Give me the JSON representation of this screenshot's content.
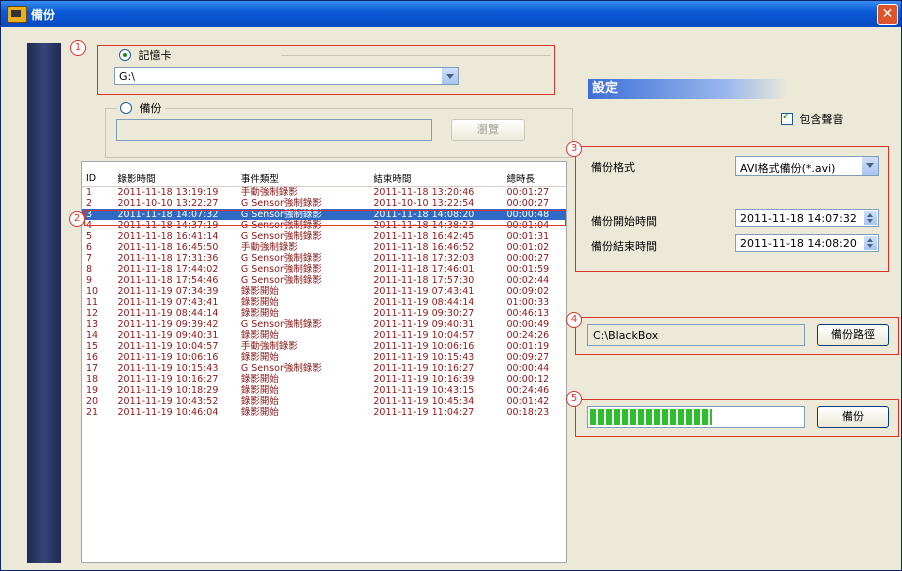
{
  "window": {
    "title": "備份",
    "close_label": "✕"
  },
  "memory_card": {
    "label": "記憶卡",
    "selected": true,
    "drive": "G:\\"
  },
  "backup_source": {
    "label": "備份",
    "selected": false,
    "path": "",
    "browse_label": "瀏覽"
  },
  "list": {
    "columns": [
      "ID",
      "錄影時間",
      "事件類型",
      "結束時間",
      "總時長"
    ],
    "selected_index": 2,
    "rows": [
      [
        "1",
        "2011-11-18 13:19:19",
        "手動強制錄影",
        "2011-11-18 13:20:46",
        "00:01:27"
      ],
      [
        "2",
        "2011-10-10 13:22:27",
        "G Sensor強制錄影",
        "2011-10-10 13:22:54",
        "00:00:27"
      ],
      [
        "3",
        "2011-11-18 14:07:32",
        "G Sensor強制錄影",
        "2011-11-18 14:08:20",
        "00:00:48"
      ],
      [
        "4",
        "2011-11-18 14:37:19",
        "G Sensor強制錄影",
        "2011-11-18 14:38:23",
        "00:01:04"
      ],
      [
        "5",
        "2011-11-18 16:41:14",
        "G Sensor強制錄影",
        "2011-11-18 16:42:45",
        "00:01:31"
      ],
      [
        "6",
        "2011-11-18 16:45:50",
        "手動強制錄影",
        "2011-11-18 16:46:52",
        "00:01:02"
      ],
      [
        "7",
        "2011-11-18 17:31:36",
        "G Sensor強制錄影",
        "2011-11-18 17:32:03",
        "00:00:27"
      ],
      [
        "8",
        "2011-11-18 17:44:02",
        "G Sensor強制錄影",
        "2011-11-18 17:46:01",
        "00:01:59"
      ],
      [
        "9",
        "2011-11-18 17:54:46",
        "G Sensor強制錄影",
        "2011-11-18 17:57:30",
        "00:02:44"
      ],
      [
        "10",
        "2011-11-19 07:34:39",
        "錄影開始",
        "2011-11-19 07:43:41",
        "00:09:02"
      ],
      [
        "11",
        "2011-11-19 07:43:41",
        "錄影開始",
        "2011-11-19 08:44:14",
        "01:00:33"
      ],
      [
        "12",
        "2011-11-19 08:44:14",
        "錄影開始",
        "2011-11-19 09:30:27",
        "00:46:13"
      ],
      [
        "13",
        "2011-11-19 09:39:42",
        "G Sensor強制錄影",
        "2011-11-19 09:40:31",
        "00:00:49"
      ],
      [
        "14",
        "2011-11-19 09:40:31",
        "錄影開始",
        "2011-11-19 10:04:57",
        "00:24:26"
      ],
      [
        "15",
        "2011-11-19 10:04:57",
        "手動強制錄影",
        "2011-11-19 10:06:16",
        "00:01:19"
      ],
      [
        "16",
        "2011-11-19 10:06:16",
        "錄影開始",
        "2011-11-19 10:15:43",
        "00:09:27"
      ],
      [
        "17",
        "2011-11-19 10:15:43",
        "G Sensor強制錄影",
        "2011-11-19 10:16:27",
        "00:00:44"
      ],
      [
        "18",
        "2011-11-19 10:16:27",
        "錄影開始",
        "2011-11-19 10:16:39",
        "00:00:12"
      ],
      [
        "19",
        "2011-11-19 10:18:29",
        "錄影開始",
        "2011-11-19 10:43:15",
        "00:24:46"
      ],
      [
        "20",
        "2011-11-19 10:43:52",
        "錄影開始",
        "2011-11-19 10:45:34",
        "00:01:42"
      ],
      [
        "21",
        "2011-11-19 10:46:04",
        "錄影開始",
        "2011-11-19 11:04:27",
        "00:18:23"
      ]
    ]
  },
  "settings": {
    "header": "設定",
    "include_audio_label": "包含聲音",
    "include_audio": true,
    "format_label": "備份格式",
    "format_value": "AVI格式備份(*.avi)",
    "start_label": "備份開始時間",
    "start_value": "2011-11-18 14:07:32",
    "end_label": "備份結束時間",
    "end_value": "2011-11-18 14:08:20",
    "path_value": "C:\\BlackBox",
    "path_button": "備份路徑",
    "progress_fraction": 0.57,
    "backup_button": "備份"
  },
  "callouts": [
    "1",
    "2",
    "3",
    "4",
    "5"
  ],
  "colors": {
    "callout": "#d9342b",
    "selection": "#316ac5",
    "row_text": "#8a1818",
    "progress": "#2cc12c"
  }
}
